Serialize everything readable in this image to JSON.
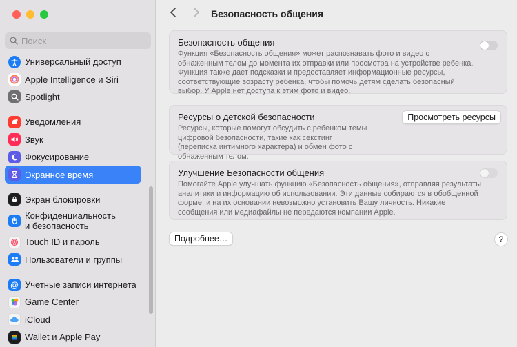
{
  "window": {
    "traffic_colors": [
      "#fe5f57",
      "#febc2e",
      "#28c840"
    ]
  },
  "search": {
    "placeholder": "Поиск"
  },
  "sidebar": {
    "items": [
      {
        "label": "Универсальный доступ",
        "icon": "accessibility-icon",
        "color": "#1b7cf5"
      },
      {
        "label": "Apple Intelligence и Siri",
        "icon": "apple-intelligence-icon",
        "color": "#ff7a59"
      },
      {
        "label": "Spotlight",
        "icon": "spotlight-icon",
        "color": "#6e6e73"
      },
      {
        "label": "Уведомления",
        "icon": "notifications-icon",
        "color": "#ff3b30"
      },
      {
        "label": "Звук",
        "icon": "sound-icon",
        "color": "#ff2d55"
      },
      {
        "label": "Фокусирование",
        "icon": "focus-icon",
        "color": "#5e5ce6"
      },
      {
        "label": "Экранное время",
        "icon": "screen-time-icon",
        "color": "#5e5ce6",
        "selected": true
      },
      {
        "label": "Экран блокировки",
        "icon": "lock-screen-icon",
        "color": "#1d1d1f"
      },
      {
        "label": "Конфиденциальность\nи безопасность",
        "icon": "privacy-hand-icon",
        "color": "#1b7cf5"
      },
      {
        "label": "Touch ID и пароль",
        "icon": "touch-id-icon",
        "color": "#f4f4f4"
      },
      {
        "label": "Пользователи и группы",
        "icon": "users-icon",
        "color": "#1b7cf5"
      },
      {
        "label": "Учетные записи интернета",
        "icon": "internet-accounts-icon",
        "color": "#1b7cf5"
      },
      {
        "label": "Game Center",
        "icon": "game-center-icon",
        "color": "#f4f4f4"
      },
      {
        "label": "iCloud",
        "icon": "icloud-icon",
        "color": "#f4f4f4"
      },
      {
        "label": "Wallet и Apple Pay",
        "icon": "wallet-icon",
        "color": "#1d1d1f"
      }
    ]
  },
  "toolbar": {
    "title": "Безопасность общения"
  },
  "cards": {
    "safety": {
      "title": "Безопасность общения",
      "text": "Функция «Безопасность общения» может распознавать фото и видео с обнаженным телом до момента их отправки или просмотра на устройстве ребенка. Функция также дает подсказки и предоставляет информационные ресурсы, соответствующие возрасту ребенка, чтобы помочь детям сделать безопасный выбор. У Apple нет доступа к этим фото и видео."
    },
    "resources": {
      "title": "Ресурсы о детской безопасности",
      "text": "Ресурсы, которые помогут обсудить с ребенком темы цифровой безопасности, такие как секстинг (переписка интимного характера) и обмен фото с обнаженным телом.",
      "button": "Просмотреть ресурсы"
    },
    "improve": {
      "title": "Улучшение Безопасности общения",
      "text": "Помогайте Apple улучшать функцию «Безопасность общения», отправляя результаты аналитики и информацию об использовании. Эти данные собираются в обобщенной форме, и на их основании невозможно установить Вашу личность. Никакие сообщения или медиафайлы не передаются компании Apple."
    }
  },
  "footer": {
    "more_button": "Подробнее…",
    "help": "?"
  }
}
